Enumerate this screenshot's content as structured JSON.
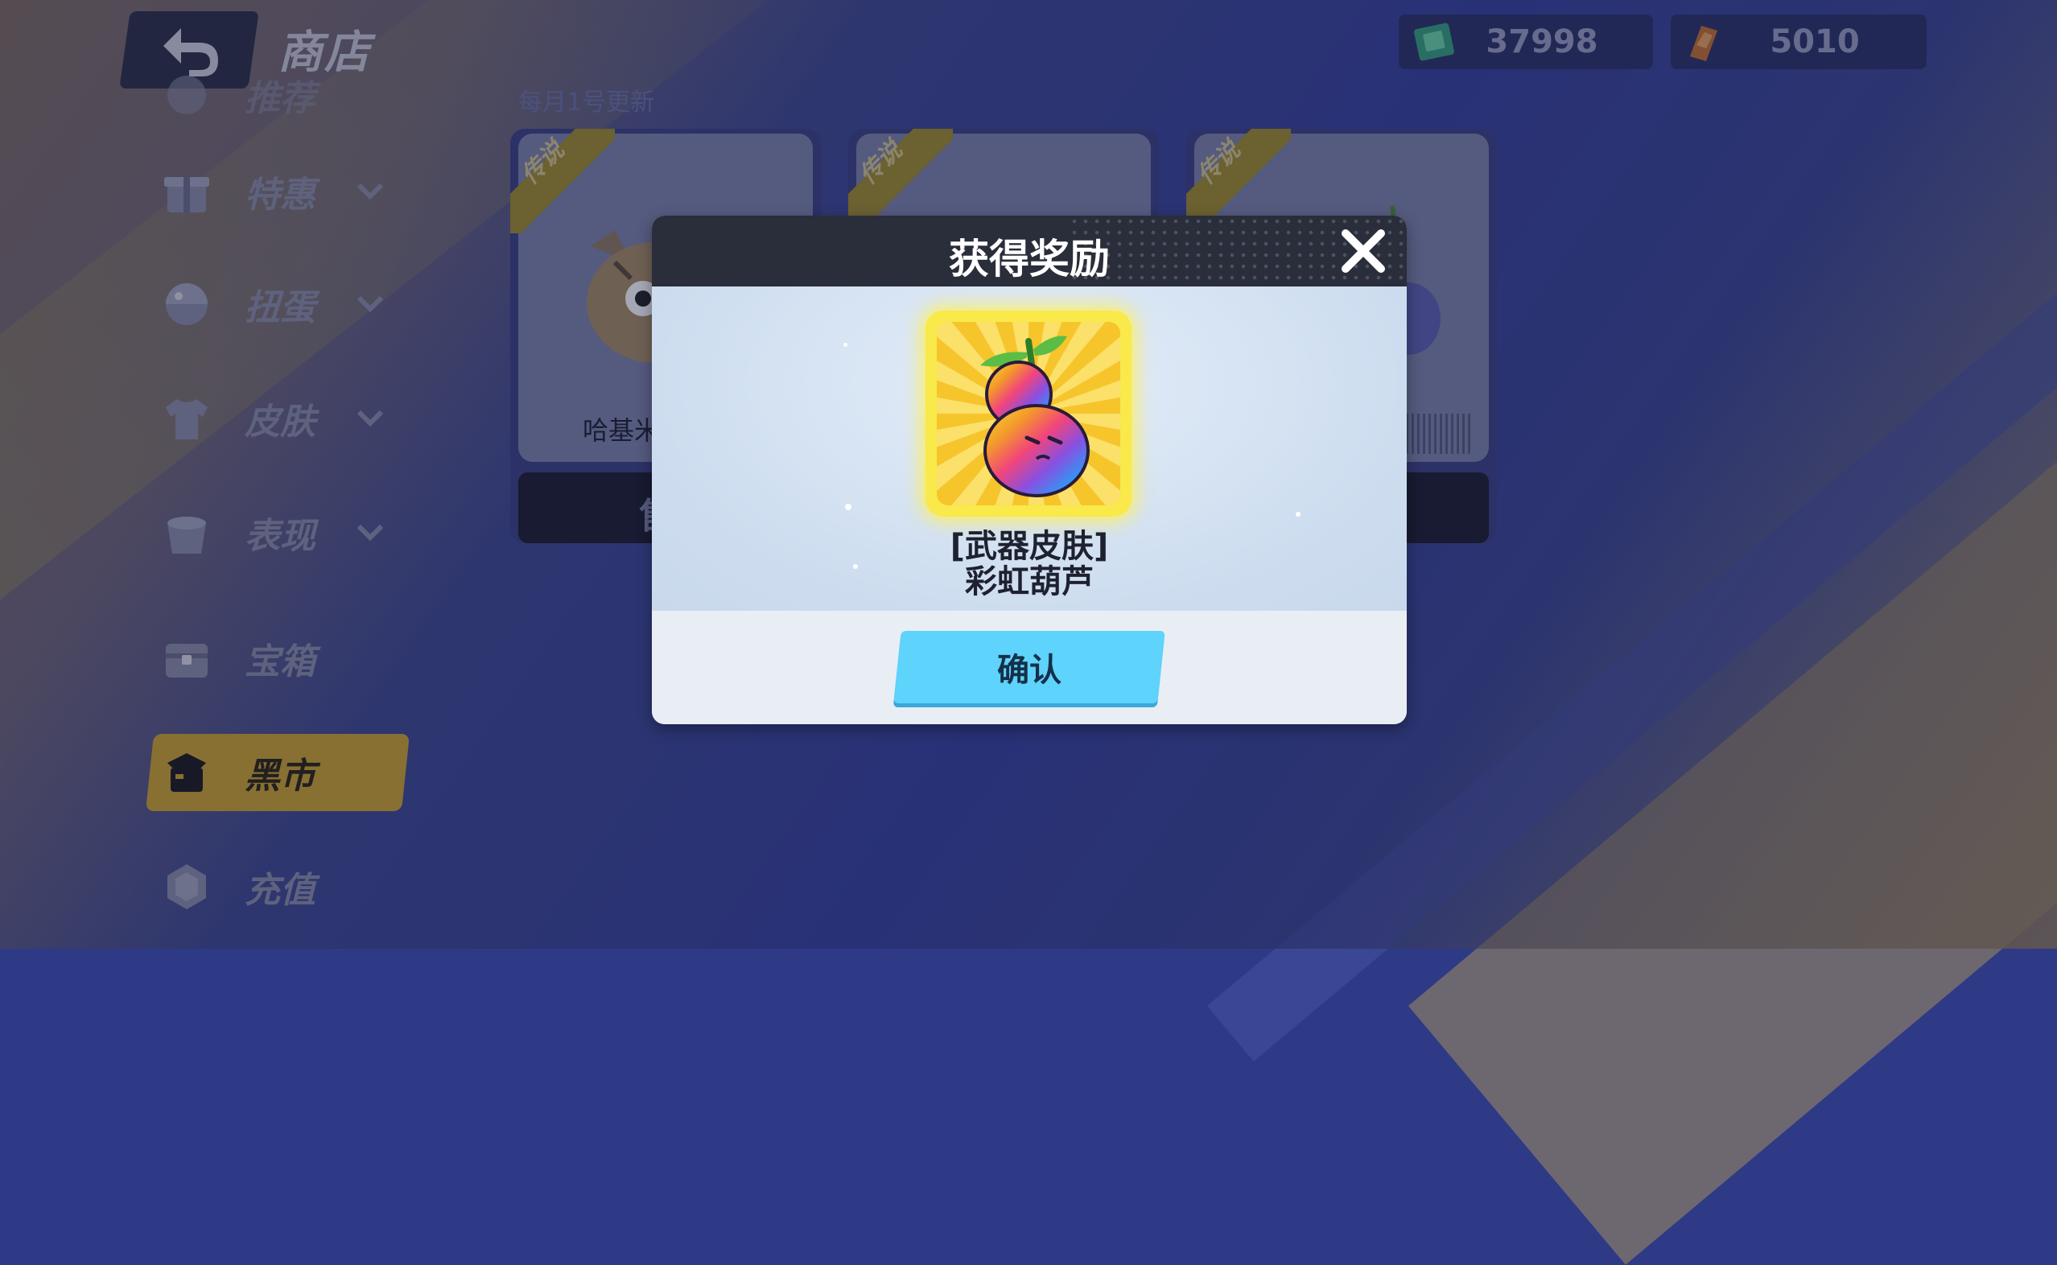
{
  "header": {
    "title": "商店",
    "currency": [
      {
        "icon": "green-ticket-icon",
        "amount": "37998"
      },
      {
        "icon": "orange-coupon-icon",
        "amount": "5010"
      }
    ]
  },
  "update_note": "每月1号更新",
  "sidebar": {
    "items": [
      {
        "label": "推荐",
        "icon": "recommend-icon"
      },
      {
        "label": "特惠",
        "icon": "gift-icon"
      },
      {
        "label": "扭蛋",
        "icon": "capsule-icon"
      },
      {
        "label": "皮肤",
        "icon": "shirt-icon"
      },
      {
        "label": "表现",
        "icon": "bucket-icon"
      },
      {
        "label": "宝箱",
        "icon": "chest-icon"
      },
      {
        "label": "黑市",
        "icon": "black-market-icon"
      },
      {
        "label": "充值",
        "icon": "gem-icon"
      }
    ],
    "active": "黑市"
  },
  "cards": [
    {
      "ribbon": "传说",
      "name": "哈基米",
      "footer": "售"
    },
    {
      "ribbon": "传说"
    },
    {
      "ribbon": "传说"
    }
  ],
  "modal": {
    "title": "获得奖励",
    "item_type": "[武器皮肤]",
    "item_name": "彩虹葫芦",
    "confirm_label": "确认"
  },
  "colors": {
    "accent_yellow": "#cda62c",
    "confirm_blue": "#5ed3fb",
    "modal_header": "#2a2d3a"
  }
}
